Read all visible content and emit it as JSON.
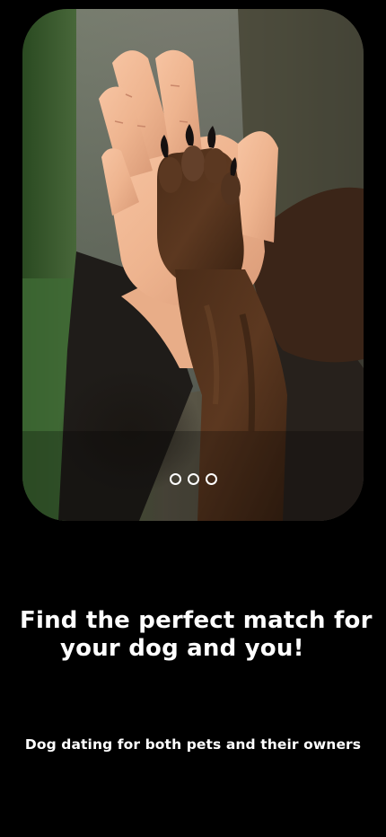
{
  "hero": {
    "image_subject": "human hand high-fiving a dog paw",
    "carousel": {
      "count": 3,
      "active_index": 0
    }
  },
  "headline": {
    "line1": "Find the perfect match for",
    "line2": "your dog and you!"
  },
  "subtext": "Dog dating for both pets and their owners",
  "colors": {
    "background": "#000000",
    "text": "#ffffff"
  }
}
